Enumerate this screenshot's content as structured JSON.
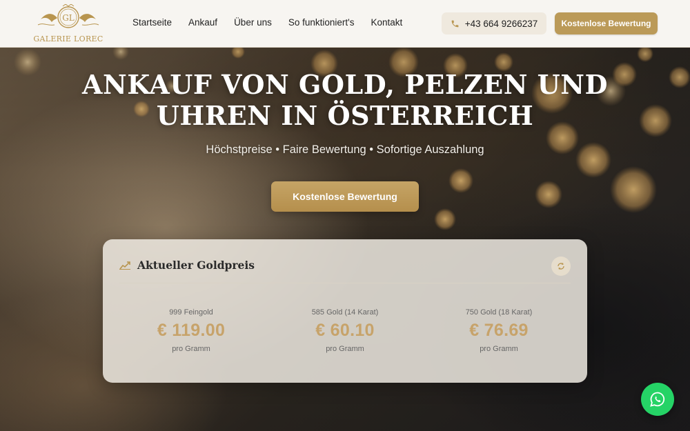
{
  "header": {
    "logo_text": "GALERIE LOREC",
    "logo_monogram": "GL",
    "nav": [
      "Startseite",
      "Ankauf",
      "Über uns",
      "So funktioniert's",
      "Kontakt"
    ],
    "phone": "+43 664 9266237",
    "cta": "Kostenlose Bewertung"
  },
  "hero": {
    "title_line1": "ANKAUF VON GOLD, PELZEN UND",
    "title_line2": "UHREN IN ÖSTERREICH",
    "subtitle": "Höchstpreise • Faire Bewertung • Sofortige Auszahlung",
    "cta": "Kostenlose Bewertung"
  },
  "gold_price": {
    "title": "Aktueller Goldpreis",
    "items": [
      {
        "label": "999 Feingold",
        "value": "€ 119.00",
        "unit": "pro Gramm"
      },
      {
        "label": "585 Gold (14 Karat)",
        "value": "€ 60.10",
        "unit": "pro Gramm"
      },
      {
        "label": "750 Gold (18 Karat)",
        "value": "€ 76.69",
        "unit": "pro Gramm"
      }
    ]
  },
  "icons": {
    "phone": "phone-icon",
    "chart": "chart-line-icon",
    "refresh": "refresh-icon",
    "whatsapp": "whatsapp-icon"
  },
  "colors": {
    "gold": "#bb9a58",
    "price_gold": "#c7a36a",
    "header_bg": "#f7f5f1",
    "whatsapp_green": "#25d366"
  }
}
